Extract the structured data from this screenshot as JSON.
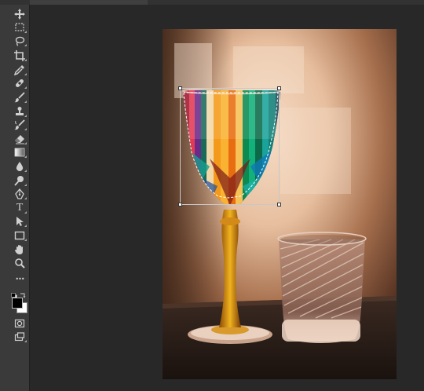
{
  "document": {
    "tab_present": true
  },
  "toolbar": {
    "tools": [
      {
        "id": "move",
        "icon": "move-icon"
      },
      {
        "id": "rect-marquee",
        "icon": "rectangular-marquee-icon"
      },
      {
        "id": "lasso",
        "icon": "lasso-icon"
      },
      {
        "id": "crop",
        "icon": "crop-icon"
      },
      {
        "id": "eyedropper",
        "icon": "eyedropper-icon"
      },
      {
        "id": "healing",
        "icon": "healing-brush-icon"
      },
      {
        "id": "brush",
        "icon": "brush-icon"
      },
      {
        "id": "stamp",
        "icon": "clone-stamp-icon"
      },
      {
        "id": "history-brush",
        "icon": "history-brush-icon"
      },
      {
        "id": "eraser",
        "icon": "eraser-icon"
      },
      {
        "id": "gradient",
        "icon": "gradient-icon"
      },
      {
        "id": "blur",
        "icon": "blur-icon"
      },
      {
        "id": "dodge",
        "icon": "dodge-icon"
      },
      {
        "id": "pen",
        "icon": "pen-icon"
      },
      {
        "id": "type",
        "icon": "type-icon",
        "label": "T"
      },
      {
        "id": "path-select",
        "icon": "path-selection-icon"
      },
      {
        "id": "rect-shape",
        "icon": "rectangle-shape-icon"
      },
      {
        "id": "hand",
        "icon": "hand-icon"
      },
      {
        "id": "zoom",
        "icon": "zoom-icon"
      },
      {
        "id": "more",
        "icon": "more-icon",
        "label": "•••"
      }
    ],
    "colors": {
      "foreground": "#000000",
      "background": "#ffffff"
    }
  },
  "canvas": {
    "background": "#282828",
    "subject": "wine-glass-and-tumbler-photo",
    "selection": "transform-box-around-glass-bowl"
  }
}
